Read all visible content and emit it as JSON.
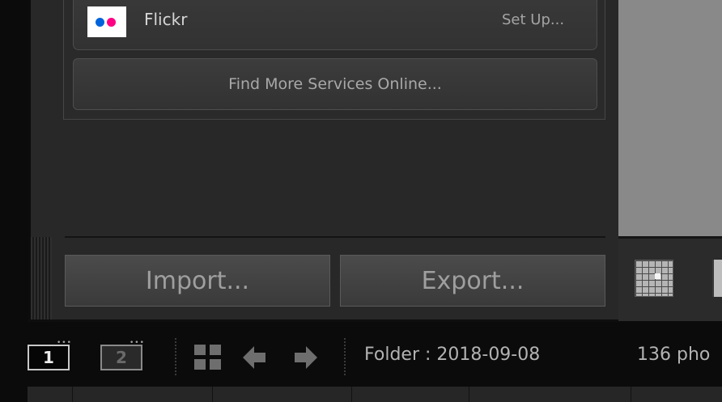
{
  "publish_services": {
    "flickr": {
      "name": "Flickr",
      "action": "Set Up..."
    },
    "find_more": "Find More Services Online..."
  },
  "buttons": {
    "import": "Import...",
    "export": "Export..."
  },
  "filmstrip": {
    "monitor_1": "1",
    "monitor_2": "2",
    "source": "Folder : 2018-09-08",
    "count": "136 pho"
  },
  "colors": {
    "flickr_blue": "#0063dc",
    "flickr_pink": "#ff0084",
    "panel_bg": "#282828",
    "preview_bg": "#898989"
  },
  "icons": [
    "flickr-logo",
    "grid-view-icon",
    "previous-arrow-icon",
    "next-arrow-icon",
    "secondary-grid-icon"
  ]
}
